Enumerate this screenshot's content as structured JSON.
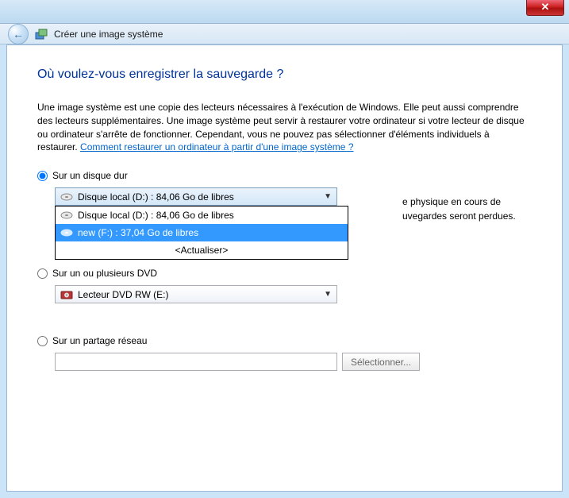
{
  "window": {
    "close": "✕"
  },
  "header": {
    "back_arrow": "←",
    "title": "Créer une image système"
  },
  "page": {
    "heading": "Où voulez-vous enregistrer la sauvegarde ?",
    "description_1": "Une image système est une copie des lecteurs nécessaires à l'exécution de Windows. Elle peut aussi comprendre des lecteurs supplémentaires. Une image système peut servir à restaurer votre ordinateur si votre lecteur de disque ou ordinateur s'arrête de fonctionner. Cependant, vous ne pouvez pas sélectionner d'éléments individuels à restaurer. ",
    "help_link": "Comment restaurer un ordinateur à partir d'une image système ?"
  },
  "options": {
    "hdd": {
      "label": "Sur un disque dur",
      "selected_text": "Disque local (D:) : 84,06 Go de libres",
      "items": [
        {
          "text": "Disque local (D:) : 84,06 Go de libres",
          "selected": false
        },
        {
          "text": "new (F:) : 37,04 Go de libres",
          "selected": true
        }
      ],
      "refresh": "<Actualiser>",
      "hint_partial_1": "e physique en cours de",
      "hint_partial_2": "uvegardes seront perdues."
    },
    "dvd": {
      "label": "Sur un ou plusieurs DVD",
      "selected_text": "Lecteur DVD RW (E:)"
    },
    "network": {
      "label": "Sur un partage réseau",
      "value": "",
      "browse": "Sélectionner..."
    }
  }
}
